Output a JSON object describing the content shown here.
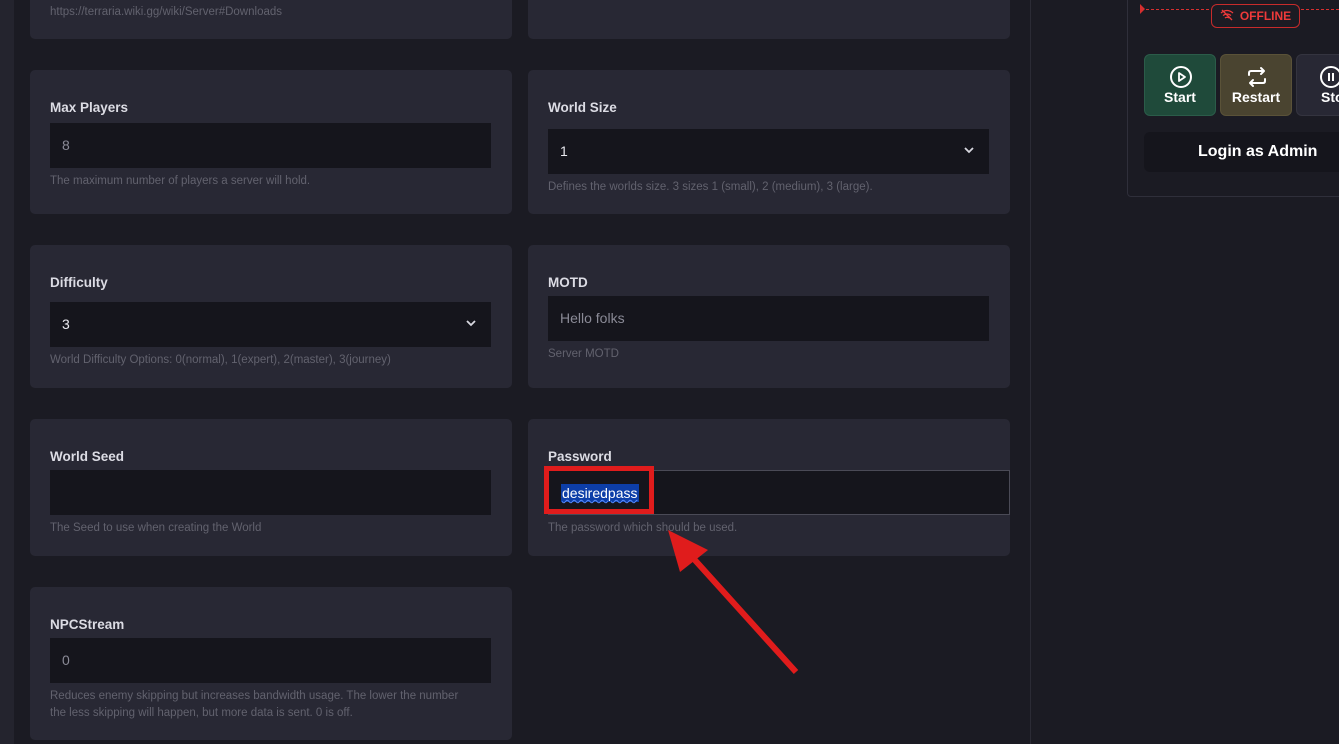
{
  "top_card": {
    "help": "https://terraria.wiki.gg/wiki/Server#Downloads"
  },
  "fields": {
    "max_players": {
      "label": "Max Players",
      "value": "8",
      "help": "The maximum number of players a server will hold."
    },
    "world_size": {
      "label": "World Size",
      "value": "1",
      "help": "Defines the worlds size. 3 sizes 1 (small), 2 (medium), 3 (large)."
    },
    "difficulty": {
      "label": "Difficulty",
      "value": "3",
      "help": "World Difficulty Options: 0(normal), 1(expert), 2(master), 3(journey)"
    },
    "motd": {
      "label": "MOTD",
      "placeholder": "Hello folks",
      "help": "Server MOTD"
    },
    "world_seed": {
      "label": "World Seed",
      "value": "",
      "help": "The Seed to use when creating the World"
    },
    "password": {
      "label": "Password",
      "value": "desiredpass",
      "help": "The password which should be used."
    },
    "npc_stream": {
      "label": "NPCStream",
      "value": "0",
      "help_line1": "Reduces enemy skipping but increases bandwidth usage. The lower the number",
      "help_line2": "the less skipping will happen, but more data is sent. 0 is off."
    }
  },
  "server_panel": {
    "status": "OFFLINE",
    "buttons": {
      "start": "Start",
      "restart": "Restart",
      "stop": "Sto"
    },
    "login": "Login as Admin"
  },
  "icons": [
    "wifi-off-icon",
    "play-icon",
    "repeat-icon",
    "pause-icon",
    "chevron-down-icon"
  ],
  "colors": {
    "offline": "#ee3a3a",
    "start_bg": "#1f4a3a",
    "restart_bg": "#4a4430",
    "annotation": "#e01c1c"
  }
}
